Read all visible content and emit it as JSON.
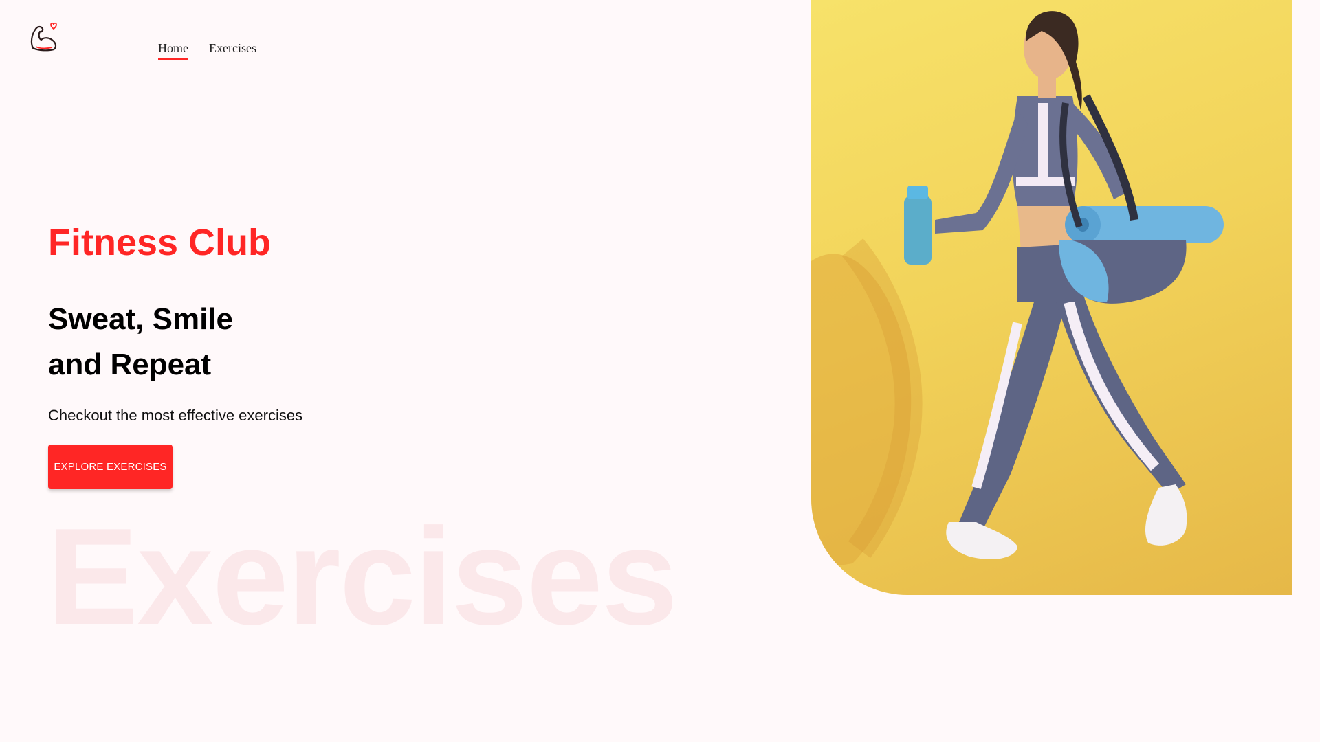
{
  "header": {
    "logo_icon": "flexed-arm-heart-icon",
    "nav": [
      {
        "label": "Home",
        "active": true
      },
      {
        "label": "Exercises",
        "active": false
      }
    ]
  },
  "hero": {
    "brand": "Fitness Club",
    "headline_line1": "Sweat, Smile",
    "headline_line2": "and Repeat",
    "subtext": "Checkout the most effective exercises",
    "cta_label": "EXPLORE EXERCISES",
    "background_word": "Exercises",
    "image_subject": "woman-walking-with-yoga-mat-and-bottle"
  },
  "colors": {
    "accent": "#ff2625",
    "background": "#fff9fa",
    "watermark": "#fbe8ea",
    "hero_image_bg": "#f7e26a"
  }
}
